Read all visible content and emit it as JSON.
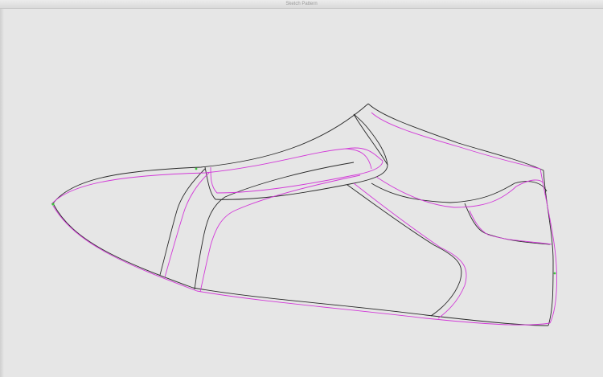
{
  "window": {
    "title": "Sketch Pattern"
  },
  "colors": {
    "background": "#e6e6e6",
    "outline": "#2a2a2a",
    "offset": "#d23ad8",
    "marker": "#3ec43e"
  }
}
